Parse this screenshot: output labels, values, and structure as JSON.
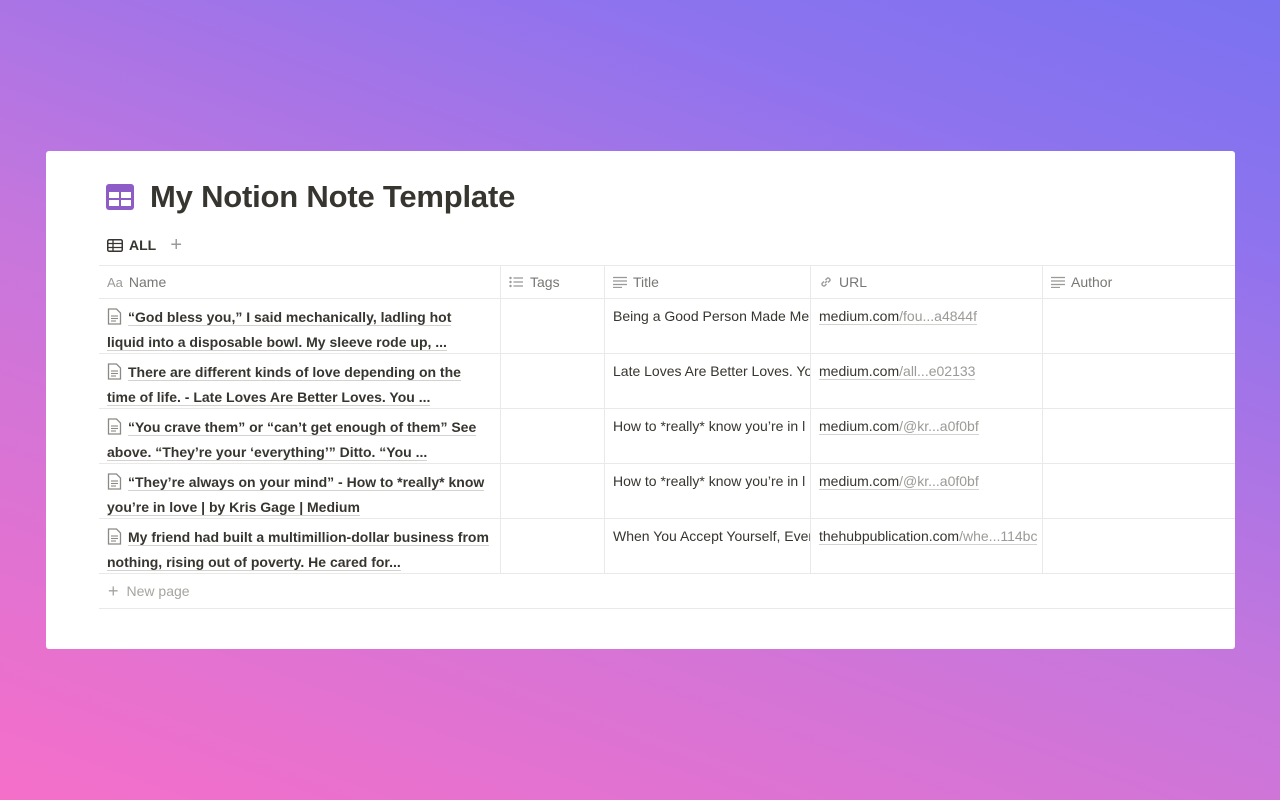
{
  "page": {
    "title": "My Notion Note Template",
    "icon": "table-icon"
  },
  "view": {
    "tab_label": "ALL",
    "add_view": "+"
  },
  "columns": {
    "name": "Name",
    "name_prefix": "Aa",
    "tags": "Tags",
    "title": "Title",
    "url": "URL",
    "author": "Author"
  },
  "rows": [
    {
      "name": "“God bless you,” I said mechanically, ladling hot liquid into a disposable bowl. My sleeve rode up, ...",
      "title": "Being a Good Person Made Me",
      "url_main": "medium.com",
      "url_rest": "/fou...a4844f",
      "author": ""
    },
    {
      "name": "There are different kinds of love depending on the time of life. - Late Loves Are Better Loves. You ...",
      "title": "Late Loves Are Better Loves. You",
      "url_main": "medium.com",
      "url_rest": "/all...e02133",
      "author": ""
    },
    {
      "name": "“You crave them” or “can’t get enough of them” See above.  “They’re your ‘everything’” Ditto.  “You ...",
      "title": "How to *really* know you’re in l",
      "url_main": "medium.com",
      "url_rest": "/@kr...a0f0bf",
      "author": ""
    },
    {
      "name": "“They’re always on your mind” - How to *really* know you’re in love | by Kris Gage | Medium",
      "title": "How to *really* know you’re in l",
      "url_main": "medium.com",
      "url_rest": "/@kr...a0f0bf",
      "author": ""
    },
    {
      "name": "My friend had built a multimillion-dollar business from nothing, rising out of poverty. He cared for...",
      "title": "When You Accept Yourself, Ever",
      "url_main": "thehubpublication.com",
      "url_rest": "/whe...114bc",
      "author": ""
    }
  ],
  "new_page_label": "New page",
  "colors": {
    "accent_icon": "#8d5cc6",
    "text": "#37352f",
    "muted": "#9b9a97",
    "border": "#e9e9e7"
  }
}
